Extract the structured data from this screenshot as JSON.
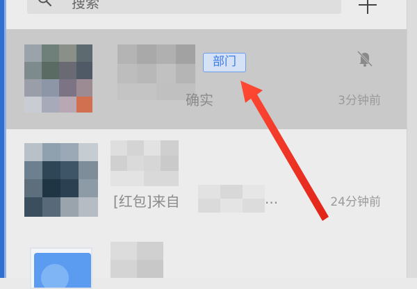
{
  "search": {
    "placeholder": "搜索",
    "icon": "search-icon"
  },
  "toolbar": {
    "add_icon": "plus-icon"
  },
  "conversations": [
    {
      "badge": "部门",
      "preview_suffix": "确实",
      "time": "3分钟前",
      "muted": true,
      "selected": true
    },
    {
      "preview_prefix": "[红包]来自",
      "preview_suffix": "...",
      "time": "24分钟前",
      "muted": false,
      "selected": false
    },
    {
      "selected": false
    }
  ],
  "colors": {
    "accent": "#3c79e4",
    "selected_bg": "#c9c9c9",
    "arrow": "#ee3322",
    "sidebar_edge": "#2f6fd0"
  },
  "annotation": {
    "type": "arrow",
    "points_to": "dept-badge"
  }
}
